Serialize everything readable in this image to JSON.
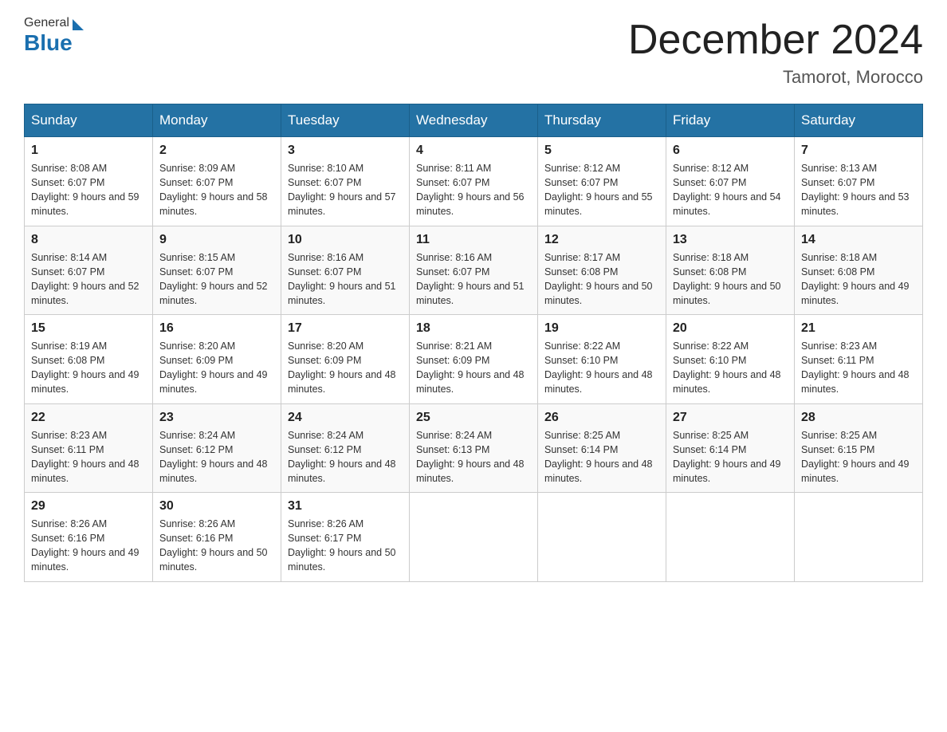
{
  "header": {
    "title": "December 2024",
    "location": "Tamorot, Morocco",
    "logo_general": "General",
    "logo_blue": "Blue"
  },
  "days_of_week": [
    "Sunday",
    "Monday",
    "Tuesday",
    "Wednesday",
    "Thursday",
    "Friday",
    "Saturday"
  ],
  "weeks": [
    [
      {
        "num": "1",
        "sunrise": "8:08 AM",
        "sunset": "6:07 PM",
        "daylight": "9 hours and 59 minutes."
      },
      {
        "num": "2",
        "sunrise": "8:09 AM",
        "sunset": "6:07 PM",
        "daylight": "9 hours and 58 minutes."
      },
      {
        "num": "3",
        "sunrise": "8:10 AM",
        "sunset": "6:07 PM",
        "daylight": "9 hours and 57 minutes."
      },
      {
        "num": "4",
        "sunrise": "8:11 AM",
        "sunset": "6:07 PM",
        "daylight": "9 hours and 56 minutes."
      },
      {
        "num": "5",
        "sunrise": "8:12 AM",
        "sunset": "6:07 PM",
        "daylight": "9 hours and 55 minutes."
      },
      {
        "num": "6",
        "sunrise": "8:12 AM",
        "sunset": "6:07 PM",
        "daylight": "9 hours and 54 minutes."
      },
      {
        "num": "7",
        "sunrise": "8:13 AM",
        "sunset": "6:07 PM",
        "daylight": "9 hours and 53 minutes."
      }
    ],
    [
      {
        "num": "8",
        "sunrise": "8:14 AM",
        "sunset": "6:07 PM",
        "daylight": "9 hours and 52 minutes."
      },
      {
        "num": "9",
        "sunrise": "8:15 AM",
        "sunset": "6:07 PM",
        "daylight": "9 hours and 52 minutes."
      },
      {
        "num": "10",
        "sunrise": "8:16 AM",
        "sunset": "6:07 PM",
        "daylight": "9 hours and 51 minutes."
      },
      {
        "num": "11",
        "sunrise": "8:16 AM",
        "sunset": "6:07 PM",
        "daylight": "9 hours and 51 minutes."
      },
      {
        "num": "12",
        "sunrise": "8:17 AM",
        "sunset": "6:08 PM",
        "daylight": "9 hours and 50 minutes."
      },
      {
        "num": "13",
        "sunrise": "8:18 AM",
        "sunset": "6:08 PM",
        "daylight": "9 hours and 50 minutes."
      },
      {
        "num": "14",
        "sunrise": "8:18 AM",
        "sunset": "6:08 PM",
        "daylight": "9 hours and 49 minutes."
      }
    ],
    [
      {
        "num": "15",
        "sunrise": "8:19 AM",
        "sunset": "6:08 PM",
        "daylight": "9 hours and 49 minutes."
      },
      {
        "num": "16",
        "sunrise": "8:20 AM",
        "sunset": "6:09 PM",
        "daylight": "9 hours and 49 minutes."
      },
      {
        "num": "17",
        "sunrise": "8:20 AM",
        "sunset": "6:09 PM",
        "daylight": "9 hours and 48 minutes."
      },
      {
        "num": "18",
        "sunrise": "8:21 AM",
        "sunset": "6:09 PM",
        "daylight": "9 hours and 48 minutes."
      },
      {
        "num": "19",
        "sunrise": "8:22 AM",
        "sunset": "6:10 PM",
        "daylight": "9 hours and 48 minutes."
      },
      {
        "num": "20",
        "sunrise": "8:22 AM",
        "sunset": "6:10 PM",
        "daylight": "9 hours and 48 minutes."
      },
      {
        "num": "21",
        "sunrise": "8:23 AM",
        "sunset": "6:11 PM",
        "daylight": "9 hours and 48 minutes."
      }
    ],
    [
      {
        "num": "22",
        "sunrise": "8:23 AM",
        "sunset": "6:11 PM",
        "daylight": "9 hours and 48 minutes."
      },
      {
        "num": "23",
        "sunrise": "8:24 AM",
        "sunset": "6:12 PM",
        "daylight": "9 hours and 48 minutes."
      },
      {
        "num": "24",
        "sunrise": "8:24 AM",
        "sunset": "6:12 PM",
        "daylight": "9 hours and 48 minutes."
      },
      {
        "num": "25",
        "sunrise": "8:24 AM",
        "sunset": "6:13 PM",
        "daylight": "9 hours and 48 minutes."
      },
      {
        "num": "26",
        "sunrise": "8:25 AM",
        "sunset": "6:14 PM",
        "daylight": "9 hours and 48 minutes."
      },
      {
        "num": "27",
        "sunrise": "8:25 AM",
        "sunset": "6:14 PM",
        "daylight": "9 hours and 49 minutes."
      },
      {
        "num": "28",
        "sunrise": "8:25 AM",
        "sunset": "6:15 PM",
        "daylight": "9 hours and 49 minutes."
      }
    ],
    [
      {
        "num": "29",
        "sunrise": "8:26 AM",
        "sunset": "6:16 PM",
        "daylight": "9 hours and 49 minutes."
      },
      {
        "num": "30",
        "sunrise": "8:26 AM",
        "sunset": "6:16 PM",
        "daylight": "9 hours and 50 minutes."
      },
      {
        "num": "31",
        "sunrise": "8:26 AM",
        "sunset": "6:17 PM",
        "daylight": "9 hours and 50 minutes."
      },
      null,
      null,
      null,
      null
    ]
  ]
}
